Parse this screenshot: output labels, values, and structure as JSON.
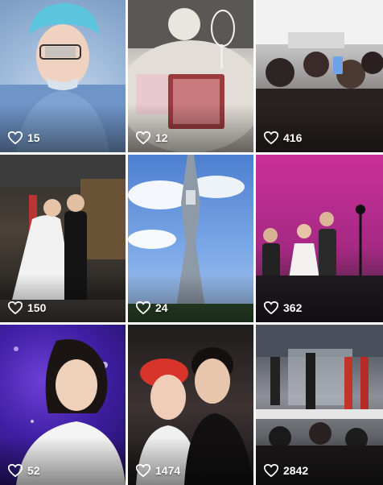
{
  "tiles": [
    {
      "likes": "15"
    },
    {
      "likes": "12"
    },
    {
      "likes": "416"
    },
    {
      "likes": "150"
    },
    {
      "likes": "24"
    },
    {
      "likes": "362"
    },
    {
      "likes": "52"
    },
    {
      "likes": "1474"
    },
    {
      "likes": "2842"
    }
  ],
  "icons": {
    "like": "heart-outline-icon"
  },
  "colors": {
    "like_text": "#ffffff"
  }
}
